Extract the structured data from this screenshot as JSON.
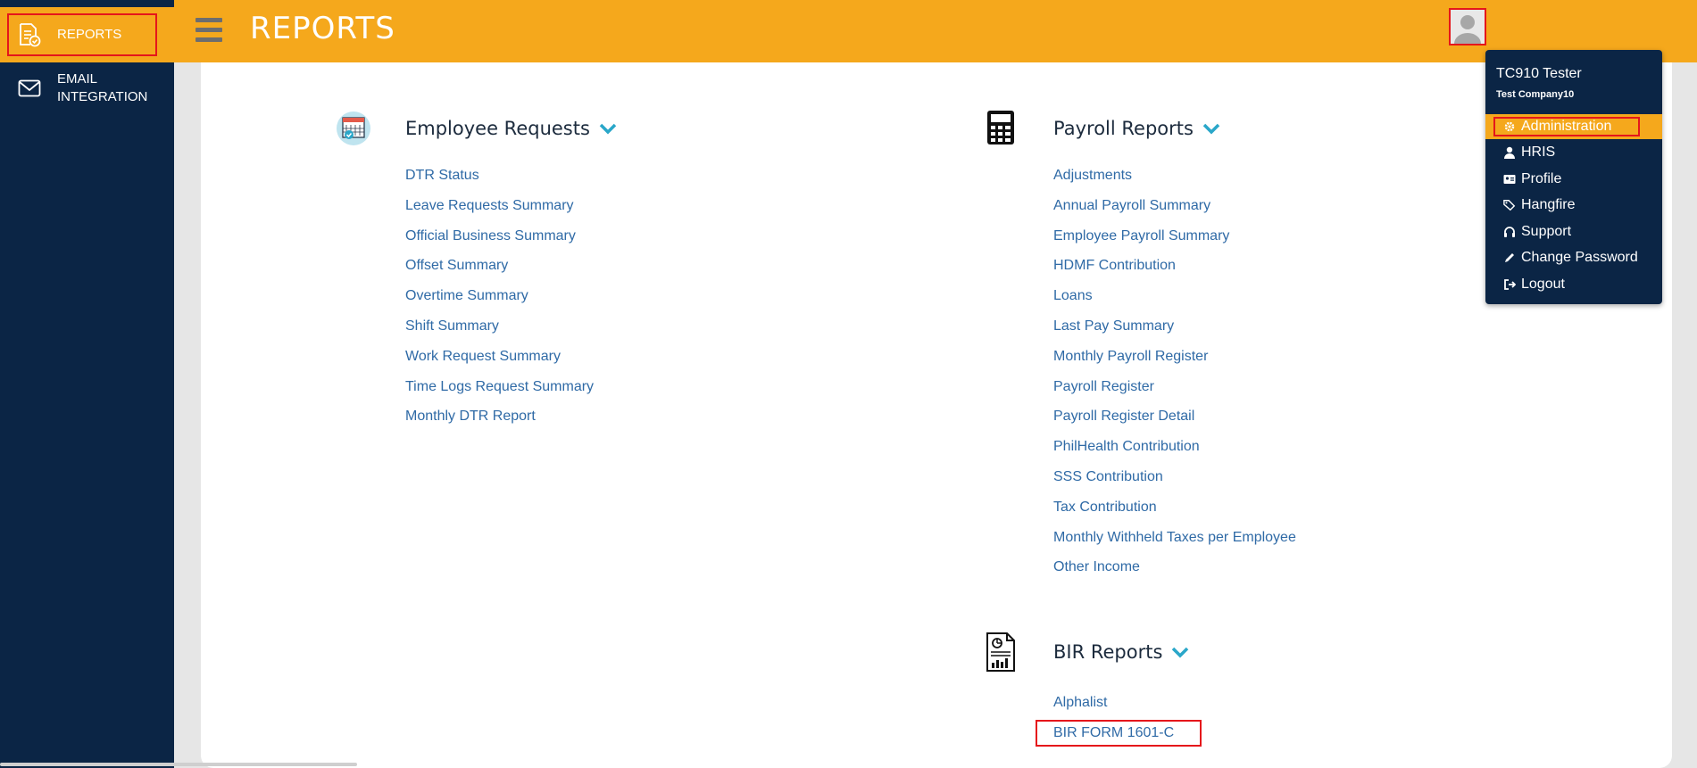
{
  "sidebar": {
    "items": [
      {
        "label": "REPORTS",
        "icon": "report-check-icon"
      },
      {
        "label_line1": "EMAIL",
        "label_line2": "INTEGRATION",
        "icon": "envelope-icon"
      }
    ]
  },
  "header": {
    "title": "REPORTS",
    "menu_icon": "hamburger-icon",
    "avatar_icon": "user-avatar-icon"
  },
  "sections": {
    "employee_requests": {
      "title": "Employee Requests",
      "icon": "calendar-check-icon",
      "links": [
        "DTR Status",
        "Leave Requests Summary",
        "Official Business Summary",
        "Offset Summary",
        "Overtime Summary",
        "Shift Summary",
        "Work Request Summary",
        "Time Logs Request Summary",
        "Monthly DTR Report"
      ]
    },
    "payroll_reports": {
      "title": "Payroll Reports",
      "icon": "calculator-icon",
      "links": [
        "Adjustments",
        "Annual Payroll Summary",
        "Employee Payroll Summary",
        "HDMF Contribution",
        "Loans",
        "Last Pay Summary",
        "Monthly Payroll Register",
        "Payroll Register",
        "Payroll Register Detail",
        "PhilHealth Contribution",
        "SSS Contribution",
        "Tax Contribution",
        "Monthly Withheld Taxes per Employee",
        "Other Income"
      ]
    },
    "bir_reports": {
      "title": "BIR Reports",
      "icon": "document-chart-icon",
      "links": [
        "Alphalist",
        "BIR FORM 1601-C"
      ]
    }
  },
  "user_menu": {
    "name": "TC910 Tester",
    "company": "Test Company10",
    "items": [
      {
        "label": "Administration",
        "icon": "gear-icon"
      },
      {
        "label": "HRIS",
        "icon": "user-icon"
      },
      {
        "label": "Profile",
        "icon": "id-card-icon"
      },
      {
        "label": "Hangfire",
        "icon": "tags-icon"
      },
      {
        "label": "Support",
        "icon": "headphones-icon"
      },
      {
        "label": "Change Password",
        "icon": "pencil-icon"
      },
      {
        "label": "Logout",
        "icon": "sign-out-icon"
      }
    ]
  },
  "colors": {
    "header": "#f5a81c",
    "sidebar": "#0b2545",
    "link": "#2f6aa6",
    "accent_chevron": "#2aa7c9",
    "highlight_box": "#e5161b"
  }
}
